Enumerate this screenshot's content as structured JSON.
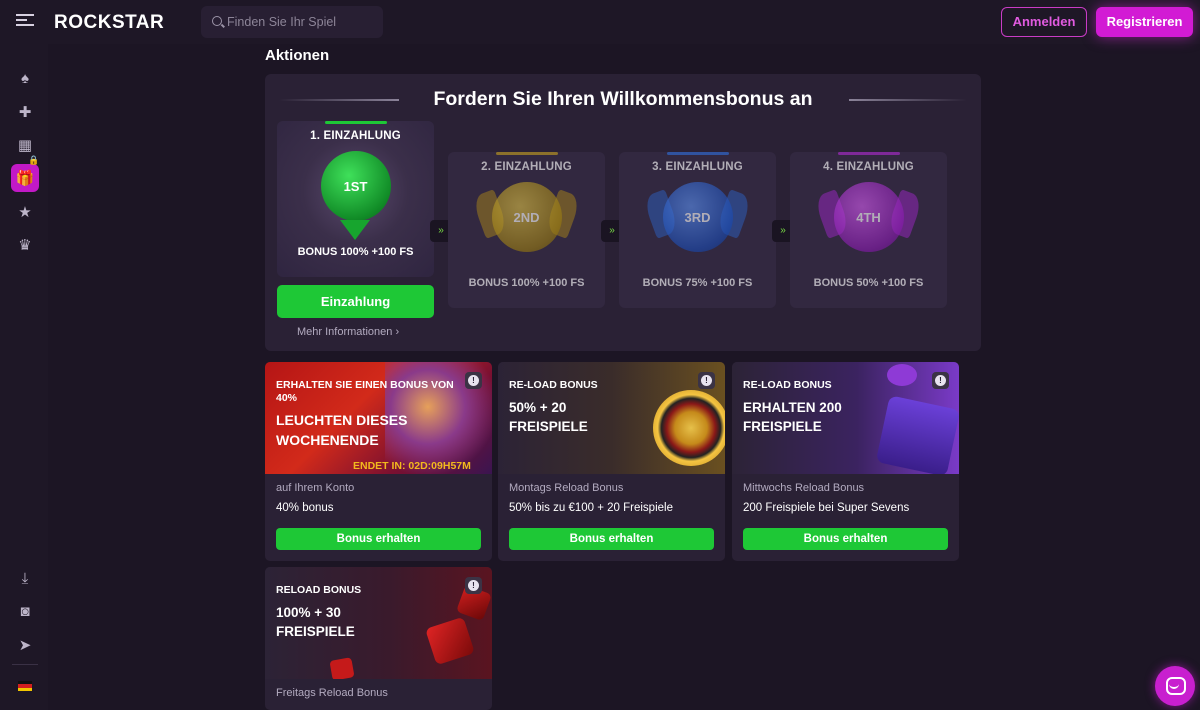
{
  "header": {
    "logo": "ROCKSTAR",
    "search_placeholder": "Finden Sie Ihr Spiel",
    "login_label": "Anmelden",
    "register_label": "Registrieren"
  },
  "sidebar": {
    "items": [
      {
        "icon": "spade-icon"
      },
      {
        "icon": "puzzle-icon"
      },
      {
        "icon": "grid-icon"
      },
      {
        "icon": "gift-icon",
        "active": true
      },
      {
        "icon": "star-icon",
        "locked": true
      },
      {
        "icon": "trophy-icon"
      }
    ],
    "bottom": [
      {
        "icon": "download-icon"
      },
      {
        "icon": "instagram-icon"
      },
      {
        "icon": "telegram-icon"
      },
      {
        "icon": "flag-de-icon"
      }
    ]
  },
  "page": {
    "title": "Aktionen"
  },
  "welcome": {
    "title": "Fordern Sie Ihren Willkommensbonus an",
    "deposits": [
      {
        "label": "1. EINZAHLUNG",
        "badge": "1ST",
        "bonus": "BONUS 100% +100 FS",
        "color": "#1ec836"
      },
      {
        "label": "2. EINZAHLUNG",
        "badge": "2ND",
        "bonus": "BONUS 100% +100 FS",
        "color": "#c8a21e"
      },
      {
        "label": "3. EINZAHLUNG",
        "badge": "3RD",
        "bonus": "BONUS 75% +100 FS",
        "color": "#2f6fe0"
      },
      {
        "label": "4. EINZAHLUNG",
        "badge": "4TH",
        "bonus": "BONUS 50% +100 FS",
        "color": "#b32ad6"
      }
    ],
    "deposit_button": "Einzahlung",
    "more_info": "Mehr Informationen"
  },
  "promos": [
    {
      "tag": "ERHALTEN SIE EINEN BONUS VON 40%",
      "headline": "LEUCHTEN DIESES WOCHENENDE",
      "countdown": "ENDET IN: 02D:09H57M",
      "subtitle": "auf Ihrem Konto",
      "description": "40% bonus",
      "cta": "Bonus erhalten"
    },
    {
      "tag": "RE-LOAD BONUS",
      "headline": "50% + 20 FREISPIELE",
      "subtitle": "Montags Reload Bonus",
      "description": "50% bis zu €100 + 20 Freispiele",
      "cta": "Bonus erhalten"
    },
    {
      "tag": "RE-LOAD BONUS",
      "headline": "ERHALTEN 200 FREISPIELE",
      "subtitle": "Mittwochs Reload Bonus",
      "description": "200 Freispiele bei Super Sevens",
      "cta": "Bonus erhalten"
    },
    {
      "tag": "RELOAD BONUS",
      "headline": "100% + 30 FREISPIELE",
      "subtitle": "Freitags Reload Bonus"
    }
  ],
  "info_symbol": "!"
}
